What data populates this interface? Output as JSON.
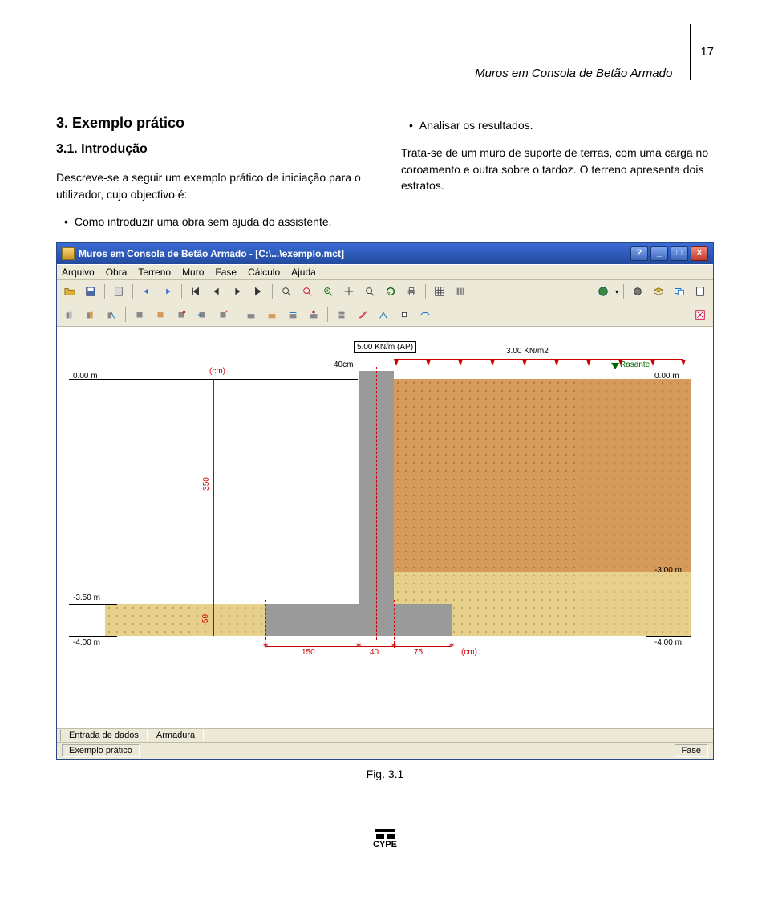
{
  "header": {
    "doc_title": "Muros em Consola de Betão Armado",
    "page_number": "17"
  },
  "section": {
    "title": "3. Exemplo prático",
    "sub_title": "3.1. Introdução",
    "intro_text": "Descreve-se a seguir um exemplo prático de iniciação para o utilizador, cujo objectivo é:",
    "bullet1": "Como introduzir uma obra sem ajuda do assistente.",
    "bullet2": "Analisar os resultados.",
    "desc_text": "Trata-se de um muro de suporte de terras, com uma carga no coroamento e outra sobre o tardoz. O terreno apresenta dois estratos."
  },
  "app": {
    "title": "Muros em Consola de Betão Armado - [C:\\...\\exemplo.mct]",
    "menu": [
      "Arquivo",
      "Obra",
      "Terreno",
      "Muro",
      "Fase",
      "Cálculo",
      "Ajuda"
    ],
    "canvas": {
      "load_point": "5.00 KN/m (AP)",
      "load_dist": "3.00 KN/m2",
      "wall_top_width": "40cm",
      "rasante": "Rasante",
      "elev_left_top": "0.00 m",
      "elev_right_top": "0.00 m",
      "unit_cm": "(cm)",
      "height_label": "350",
      "foot_height": "50",
      "elev_left_350": "-3.50 m",
      "elev_left_400": "-4.00 m",
      "elev_right_300": "-3.00 m",
      "elev_right_400": "-4.00 m",
      "dim_heel": "150",
      "dim_stem": "40",
      "dim_toe": "75"
    },
    "tabs": {
      "tab1": "Entrada de dados",
      "tab2": "Armadura"
    },
    "status": {
      "left": "Exemplo prático",
      "right": "Fase"
    }
  },
  "fig_caption": "Fig. 3.1",
  "footer_brand": "CYPE"
}
